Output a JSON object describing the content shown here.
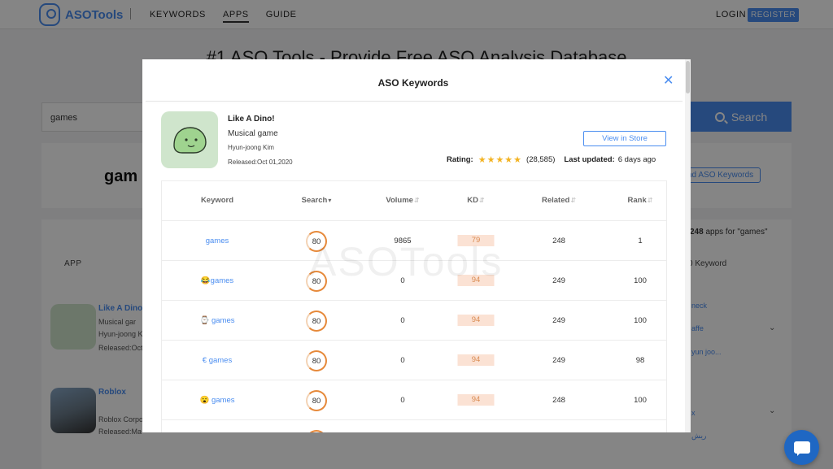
{
  "header": {
    "logo_text": "ASOTools",
    "nav": [
      "KEYWORDS",
      "APPS",
      "GUIDE"
    ],
    "active_nav": "APPS",
    "login": "LOGIN",
    "register": "REGISTER"
  },
  "background": {
    "hero_title": "#1 ASO Tools - Provide Free ASO Analysis Database",
    "search_value": "games",
    "search_button": "Search",
    "query_heading": "gam",
    "find_keywords_button": "nd ASO Keywords",
    "result_count": "248",
    "result_count_text": " apps for \"games\"",
    "col_app": "APP",
    "col_keyword": "0 Keyword",
    "apps": [
      {
        "name": "Like A Dino",
        "line1": "Musical gar",
        "line2": "Hyun-joong K",
        "line3": "Released:Oct",
        "kw1": "neck",
        "kw2": "affe",
        "kw3": "yun joo..."
      },
      {
        "name": "Roblox",
        "line1": "Roblox Corpo",
        "line2": "Released:Ma",
        "kw1": "x",
        "kw2": "ريش"
      }
    ]
  },
  "modal": {
    "title": "ASO Keywords",
    "close_icon": "close-icon",
    "app": {
      "name": "Like A Dino!",
      "genre": "Musical game",
      "developer": "Hyun-joong Kim",
      "released": "Released:Oct 01,2020",
      "view_store": "View in Store",
      "rating_label": "Rating:",
      "rating_stars": "★★★★★",
      "rating_count": "(28,585)",
      "updated_label": "Last updated:",
      "updated_value": "6 days ago"
    },
    "columns": {
      "keyword": "Keyword",
      "search": "Search",
      "volume": "Volume",
      "kd": "KD",
      "related": "Related",
      "rank": "Rank"
    },
    "watermark": "ASOTools",
    "rows": [
      {
        "keyword": "games",
        "search": "80",
        "volume": "9865",
        "kd": "79",
        "related": "248",
        "rank": "1"
      },
      {
        "keyword": "😂games",
        "search": "80",
        "volume": "0",
        "kd": "94",
        "related": "249",
        "rank": "100"
      },
      {
        "keyword": "⌚ games",
        "search": "80",
        "volume": "0",
        "kd": "94",
        "related": "249",
        "rank": "100"
      },
      {
        "keyword": "€ games",
        "search": "80",
        "volume": "0",
        "kd": "94",
        "related": "249",
        "rank": "98"
      },
      {
        "keyword": "😮 games",
        "search": "80",
        "volume": "0",
        "kd": "94",
        "related": "248",
        "rank": "100"
      },
      {
        "keyword": "",
        "search": "80",
        "volume": "",
        "kd": "",
        "related": "",
        "rank": ""
      }
    ]
  },
  "colors": {
    "accent": "#4a8df0",
    "ring": "#e6893a",
    "kd_bg": "#fbe2d4",
    "star": "#f3b322"
  }
}
